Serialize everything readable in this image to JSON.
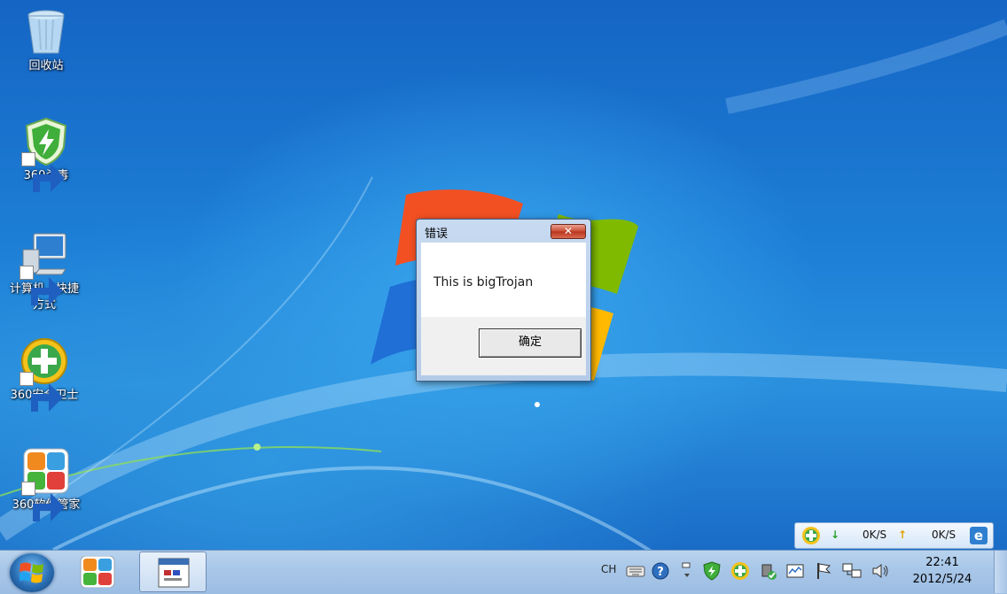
{
  "desktop": {
    "icons": [
      {
        "label": "回收站",
        "icon": "recycle-bin-icon"
      },
      {
        "label": "360杀毒",
        "icon": "360-antivirus-icon"
      },
      {
        "label": "计算机 - 快捷",
        "label2": "方式",
        "icon": "computer-icon"
      },
      {
        "label": "360安全卫士",
        "icon": "360-safeguard-icon"
      },
      {
        "label": "360软件管家",
        "icon": "360-software-manager-icon"
      }
    ]
  },
  "dialog": {
    "title": "错误",
    "close_label": "✕",
    "message": "This is bigTrojan",
    "ok_label": "确定"
  },
  "speed_widget": {
    "download": "0K/S",
    "upload": "0K/S"
  },
  "taskbar": {
    "language": "CH",
    "time": "22:41",
    "date": "2012/5/24"
  }
}
